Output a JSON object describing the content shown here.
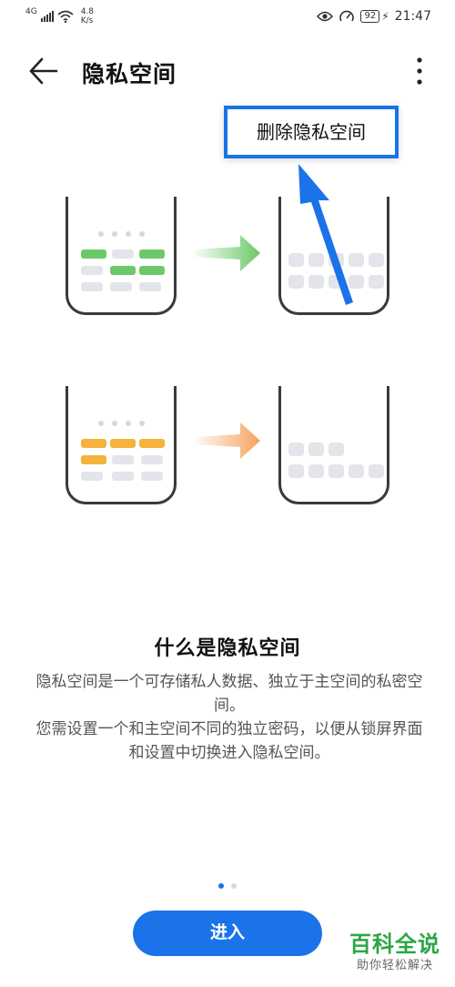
{
  "status_bar": {
    "network": "4G",
    "speed_value": "4.8",
    "speed_unit": "K/s",
    "battery": "92",
    "time": "21:47"
  },
  "app_bar": {
    "title": "隐私空间"
  },
  "popup_menu": {
    "delete_label": "删除隐私空间"
  },
  "illustration": {
    "colors": {
      "green": "#6cc96a",
      "orange": "#f5b23c",
      "gray": "#e3e5ea",
      "arrow_blue": "#1a73e8"
    }
  },
  "description": {
    "title": "什么是隐私空间",
    "paragraph1": "隐私空间是一个可存储私人数据、独立于主空间的私密空间。",
    "paragraph2": "您需设置一个和主空间不同的独立密码，以便从锁屏界面和设置中切换进入隐私空间。"
  },
  "pager": {
    "active_index": 1,
    "total": 2
  },
  "enter_button": {
    "label": "进入"
  },
  "watermark": {
    "main": "百科全说",
    "sub": "助你轻松解决"
  }
}
